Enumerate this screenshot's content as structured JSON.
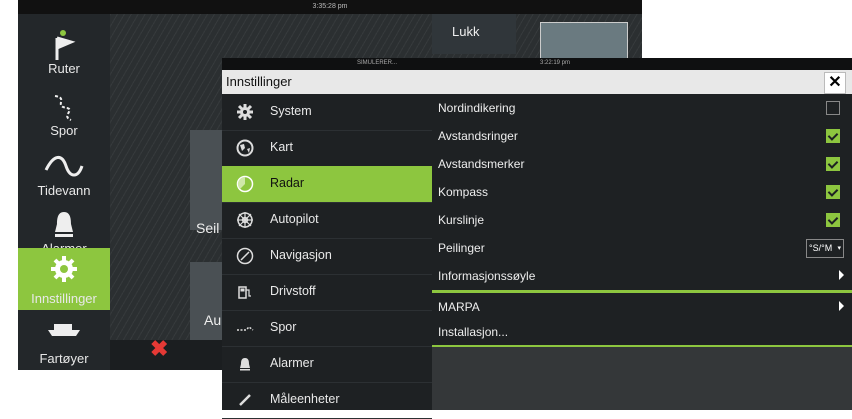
{
  "background_screen": {
    "clock": "3:35:28 pm",
    "close_label": "Lukk",
    "tile_seil": "Seil",
    "tile_au": "Au",
    "sidebar": [
      {
        "label": "Ruter",
        "icon": "route-flag-icon"
      },
      {
        "label": "Spor",
        "icon": "trail-icon"
      },
      {
        "label": "Tidevann",
        "icon": "tide-wave-icon"
      },
      {
        "label": "Alarmer",
        "icon": "bell-icon"
      },
      {
        "label": "Innstillinger",
        "icon": "gear-icon",
        "active": true
      },
      {
        "label": "Fartøyer",
        "icon": "vessel-icon"
      }
    ]
  },
  "window": {
    "simulator": "SIMULERER...",
    "clock": "3:22:19 pm",
    "title": "Innstillinger",
    "close_icon": "close-icon",
    "accent_color": "#8dc63f",
    "menu": [
      {
        "label": "System",
        "icon": "gear-icon"
      },
      {
        "label": "Kart",
        "icon": "globe-icon"
      },
      {
        "label": "Radar",
        "icon": "radar-icon",
        "active": true
      },
      {
        "label": "Autopilot",
        "icon": "steering-wheel-icon"
      },
      {
        "label": "Navigasjon",
        "icon": "compass-icon"
      },
      {
        "label": "Drivstoff",
        "icon": "fuel-pump-icon"
      },
      {
        "label": "Spor",
        "icon": "trail-icon"
      },
      {
        "label": "Alarmer",
        "icon": "bell-icon"
      },
      {
        "label": "Måleenheter",
        "icon": "ruler-icon"
      }
    ],
    "settings": {
      "nordindikering": {
        "label": "Nordindikering",
        "checked": false
      },
      "avstandsringer": {
        "label": "Avstandsringer",
        "checked": true
      },
      "avstandsmerker": {
        "label": "Avstandsmerker",
        "checked": true
      },
      "kompass": {
        "label": "Kompass",
        "checked": true
      },
      "kurslinje": {
        "label": "Kurslinje",
        "checked": true
      },
      "peilinger": {
        "label": "Peilinger",
        "value": "°S/°M"
      },
      "informasjonssoyle": {
        "label": "Informasjonssøyle"
      },
      "marpa": {
        "label": "MARPA"
      },
      "installasjon": {
        "label": "Installasjon..."
      }
    }
  }
}
